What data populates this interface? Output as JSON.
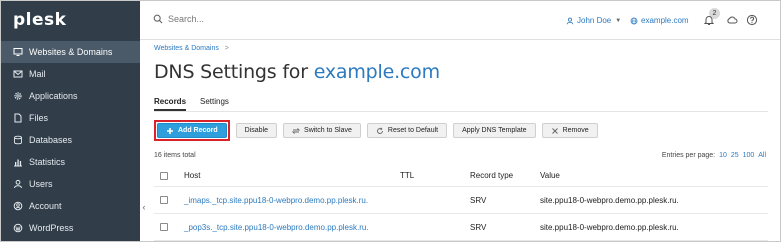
{
  "app": {
    "logo": "plesk"
  },
  "sidebar": {
    "items": [
      {
        "label": "Websites & Domains",
        "icon": "monitor-icon",
        "active": true
      },
      {
        "label": "Mail",
        "icon": "mail-icon"
      },
      {
        "label": "Applications",
        "icon": "gear-icon"
      },
      {
        "label": "Files",
        "icon": "file-icon"
      },
      {
        "label": "Databases",
        "icon": "database-icon"
      },
      {
        "label": "Statistics",
        "icon": "chart-icon"
      },
      {
        "label": "Users",
        "icon": "user-icon"
      },
      {
        "label": "Account",
        "icon": "account-icon"
      },
      {
        "label": "WordPress",
        "icon": "wordpress-icon"
      }
    ],
    "collapse_glyph": "‹"
  },
  "header": {
    "search_placeholder": "Search...",
    "user_name": "John Doe",
    "domain": "example.com",
    "notification_count": "2"
  },
  "main": {
    "breadcrumb": "Websites & Domains",
    "breadcrumb_sep": ">",
    "title_prefix": "DNS Settings for",
    "title_domain": "example.com",
    "tabs": [
      {
        "label": "Records",
        "active": true
      },
      {
        "label": "Settings"
      }
    ],
    "toolbar": {
      "add": "Add Record",
      "disable": "Disable",
      "switch": "Switch to Slave",
      "reset": "Reset to Default",
      "apply": "Apply DNS Template",
      "remove": "Remove"
    },
    "items_total": "16 items total",
    "per_page_label": "Entries per page:",
    "per_page_options": [
      "10",
      "25",
      "100",
      "All"
    ],
    "table": {
      "headers": {
        "host": "Host",
        "ttl": "TTL",
        "type": "Record type",
        "value": "Value"
      },
      "rows": [
        {
          "host": "_imaps._tcp.site.ppu18-0-webpro.demo.pp.plesk.ru.",
          "ttl": "",
          "type": "SRV",
          "value": "site.ppu18-0-webpro.demo.pp.plesk.ru."
        },
        {
          "host": "_pop3s._tcp.site.ppu18-0-webpro.demo.pp.plesk.ru.",
          "ttl": "",
          "type": "SRV",
          "value": "site.ppu18-0-webpro.demo.pp.plesk.ru."
        }
      ]
    }
  }
}
